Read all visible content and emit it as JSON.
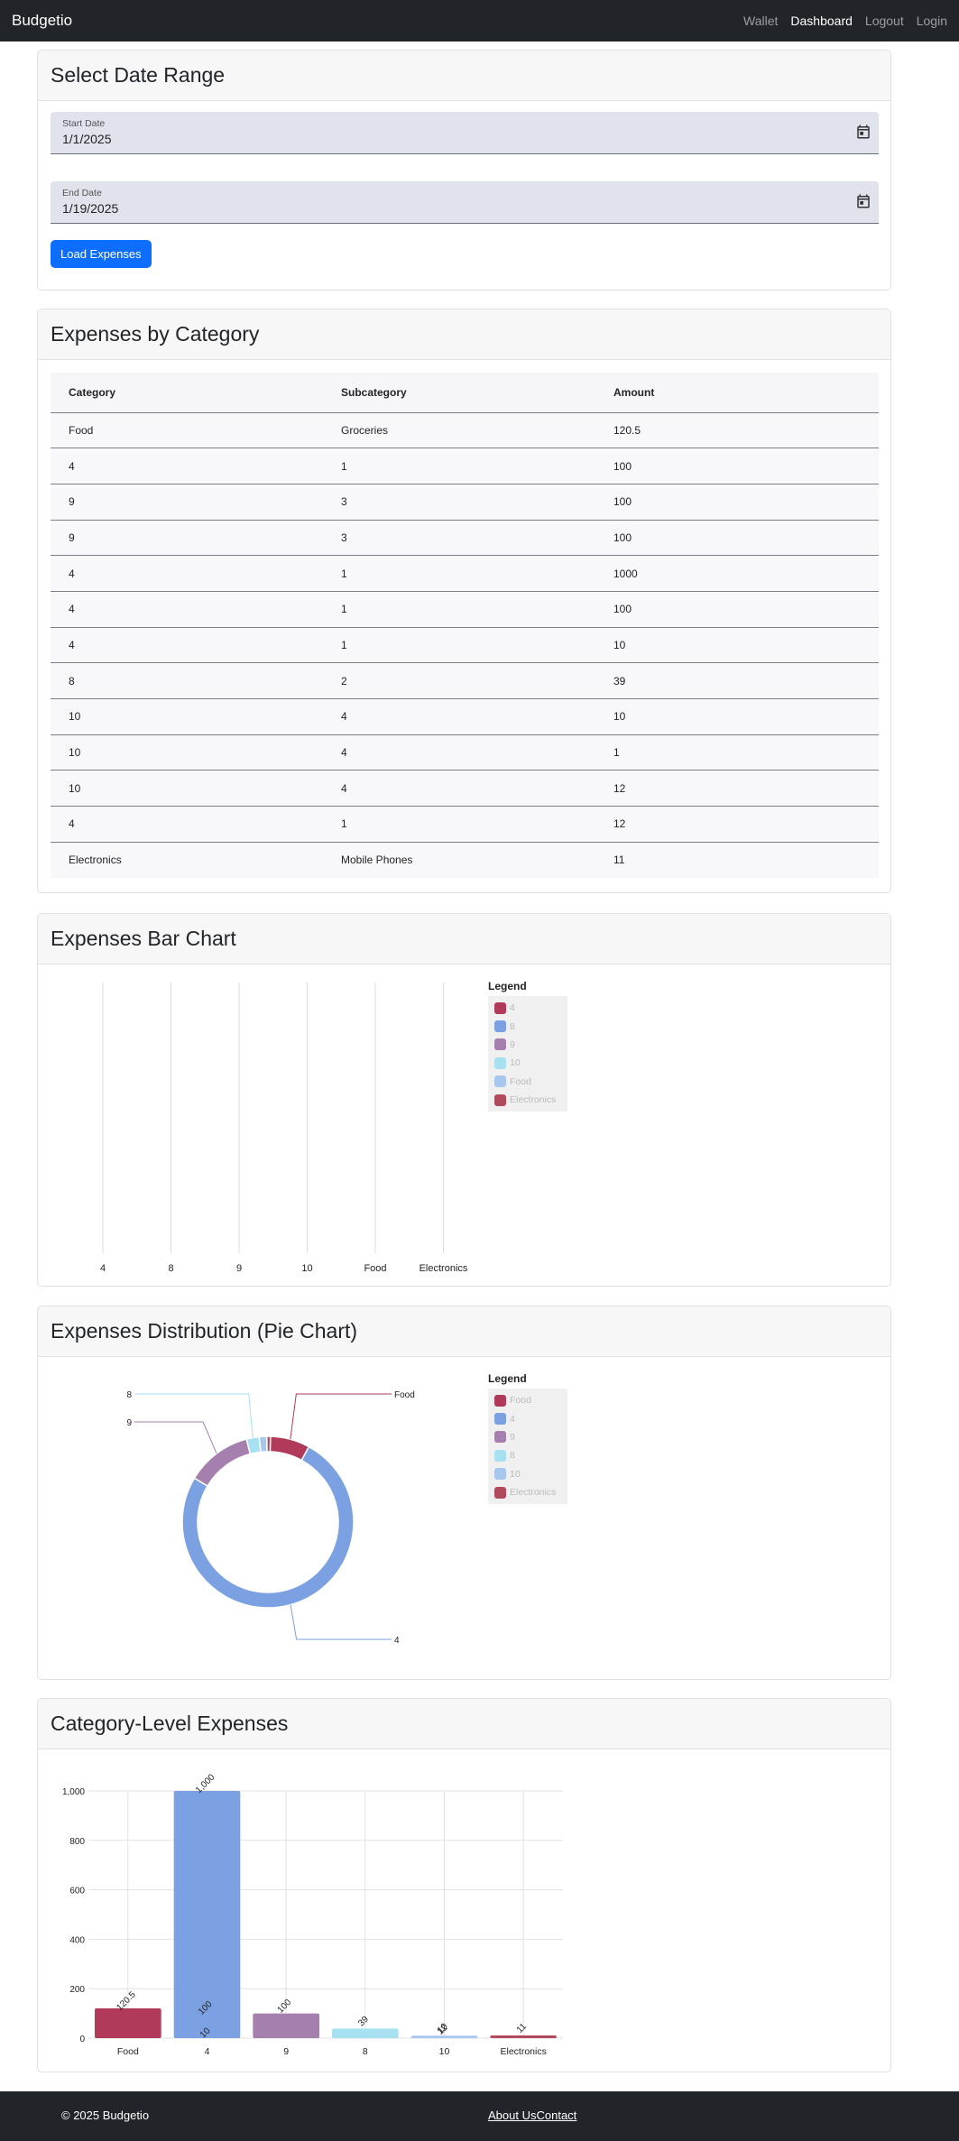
{
  "colors": {
    "crimson": "#b13a5a",
    "blue": "#7ba1e3",
    "purple": "#a57fae",
    "light_cyan": "#a7e0f0",
    "light_blue": "#a8c7ef",
    "red_brown": "#b04a5c",
    "accent": "#0d6efd"
  },
  "navbar": {
    "brand": "Budgetio",
    "links": [
      "Wallet",
      "Dashboard",
      "Logout",
      "Login"
    ],
    "active": "Dashboard"
  },
  "date_range": {
    "title": "Select Date Range",
    "start_label": "Start Date",
    "start_value": "1/1/2025",
    "end_label": "End Date",
    "end_value": "1/19/2025",
    "button_label": "Load Expenses",
    "icon": "calendar-icon"
  },
  "expenses_table": {
    "title": "Expenses by Category",
    "columns": [
      "Category",
      "Subcategory",
      "Amount"
    ],
    "rows": [
      [
        "Food",
        "Groceries",
        "120.5"
      ],
      [
        "4",
        "1",
        "100"
      ],
      [
        "9",
        "3",
        "100"
      ],
      [
        "9",
        "3",
        "100"
      ],
      [
        "4",
        "1",
        "1000"
      ],
      [
        "4",
        "1",
        "100"
      ],
      [
        "4",
        "1",
        "10"
      ],
      [
        "8",
        "2",
        "39"
      ],
      [
        "10",
        "4",
        "10"
      ],
      [
        "10",
        "4",
        "1"
      ],
      [
        "10",
        "4",
        "12"
      ],
      [
        "4",
        "1",
        "12"
      ],
      [
        "Electronics",
        "Mobile Phones",
        "11"
      ]
    ]
  },
  "bar_chart_section": {
    "title": "Expenses Bar Chart",
    "legend_title": "Legend",
    "legend": [
      {
        "label": "4",
        "color": "#b13a5a"
      },
      {
        "label": "8",
        "color": "#7ba1e3"
      },
      {
        "label": "9",
        "color": "#a57fae"
      },
      {
        "label": "10",
        "color": "#a7e0f0"
      },
      {
        "label": "Food",
        "color": "#a8c7ef"
      },
      {
        "label": "Electronics",
        "color": "#b04a5c"
      }
    ]
  },
  "pie_section": {
    "title": "Expenses Distribution (Pie Chart)",
    "legend_title": "Legend",
    "legend": [
      {
        "label": "Food",
        "color": "#b13a5a"
      },
      {
        "label": "4",
        "color": "#7ba1e3"
      },
      {
        "label": "9",
        "color": "#a57fae"
      },
      {
        "label": "8",
        "color": "#a7e0f0"
      },
      {
        "label": "10",
        "color": "#a8c7ef"
      },
      {
        "label": "Electronics",
        "color": "#b04a5c"
      }
    ]
  },
  "category_section": {
    "title": "Category-Level Expenses"
  },
  "chart_data": [
    {
      "type": "bar",
      "categories": [
        "4",
        "8",
        "9",
        "10",
        "Food",
        "Electronics"
      ],
      "values": [],
      "legend_placement": "right",
      "grid": true
    },
    {
      "type": "pie",
      "donut": true,
      "slices": [
        {
          "label": "Food",
          "value": 120.5,
          "color": "#b13a5a"
        },
        {
          "label": "4",
          "value": 1222,
          "color": "#7ba1e3"
        },
        {
          "label": "9",
          "value": 200,
          "color": "#a57fae"
        },
        {
          "label": "8",
          "value": 39,
          "color": "#a7e0f0"
        },
        {
          "label": "10",
          "value": 23,
          "color": "#a8c7ef"
        },
        {
          "label": "Electronics",
          "value": 11,
          "color": "#b04a5c"
        }
      ],
      "callout_labels": [
        "8",
        "9",
        "Food",
        "4"
      ],
      "legend_placement": "right"
    },
    {
      "type": "bar",
      "categories": [
        "Food",
        "4",
        "9",
        "8",
        "10",
        "Electronics"
      ],
      "values": [
        120.5,
        1000,
        100,
        39,
        10,
        11
      ],
      "overlay_labels": [
        {
          "category": "4",
          "labels": [
            "100",
            "10"
          ]
        },
        {
          "category": "10",
          "labels": [
            "12"
          ]
        }
      ],
      "colors": [
        "#b13a5a",
        "#7ba1e3",
        "#a57fae",
        "#a7e0f0",
        "#a8c7ef",
        "#b04a5c"
      ],
      "yticks": [
        "0",
        "200",
        "400",
        "600",
        "800",
        "1,000"
      ],
      "value_labels": [
        "120.5",
        "1,000",
        "100",
        "39",
        "10",
        "11"
      ],
      "ylim": [
        0,
        1000
      ],
      "grid": true
    }
  ],
  "footer": {
    "copyright": "© 2025 Budgetio",
    "links": [
      "About Us",
      "Contact"
    ]
  }
}
